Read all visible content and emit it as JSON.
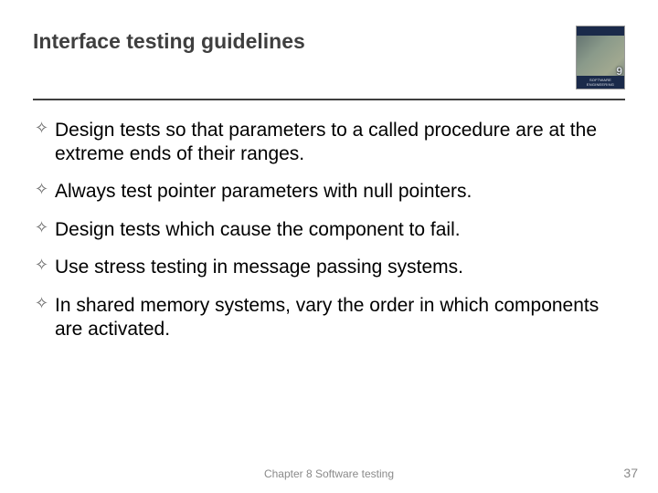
{
  "title": "Interface testing guidelines",
  "book_edition": "9",
  "bullets": [
    "Design tests so that parameters to a called procedure are at the extreme ends of their ranges.",
    "Always test pointer parameters with null pointers.",
    "Design tests which cause the component to fail.",
    "Use stress testing in message passing systems.",
    "In shared memory systems, vary the order in which components are activated."
  ],
  "footer_center": "Chapter 8 Software testing",
  "footer_right": "37"
}
